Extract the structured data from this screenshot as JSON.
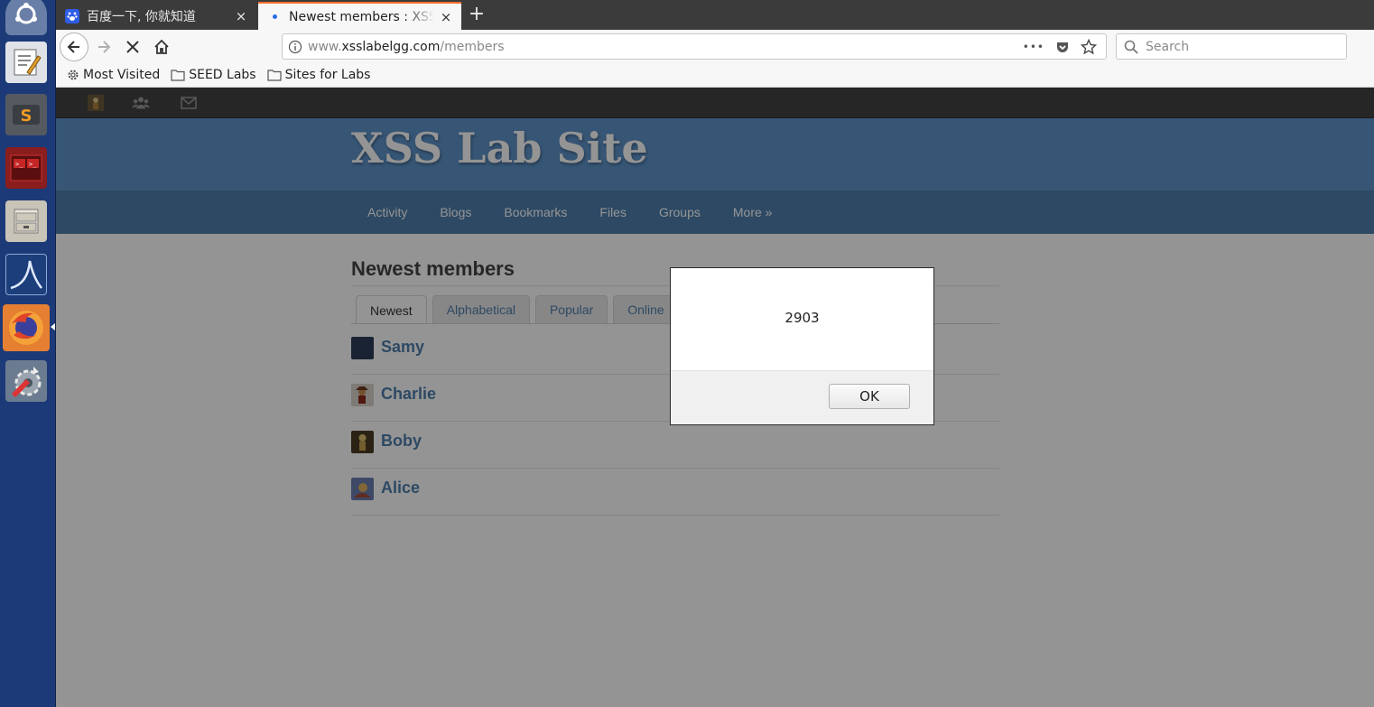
{
  "launcher": {
    "apps": [
      "ubuntu-dash",
      "text-editor",
      "sublime-text",
      "terminal",
      "files",
      "wireshark",
      "firefox",
      "system-settings"
    ]
  },
  "browser": {
    "tabs": [
      {
        "title": "百度一下, 你就知道",
        "close": "×"
      },
      {
        "title": "Newest members : XSS Lab Site",
        "close": "×"
      }
    ],
    "new_tab": "+",
    "url": {
      "prefix": "www.",
      "domain": "xsslabelgg.com",
      "path": "/members"
    },
    "search_placeholder": "Search",
    "url_more": "•••",
    "bookmarks": [
      "Most Visited",
      "SEED Labs",
      "Sites for Labs"
    ]
  },
  "site": {
    "title": "XSS Lab Site",
    "nav": [
      "Activity",
      "Blogs",
      "Bookmarks",
      "Files",
      "Groups",
      "More »"
    ],
    "page_title": "Newest members",
    "tabs": [
      "Newest",
      "Alphabetical",
      "Popular",
      "Online"
    ],
    "members": [
      "Samy",
      "Charlie",
      "Boby",
      "Alice"
    ]
  },
  "dialog": {
    "message": "2903",
    "ok_label": "OK"
  },
  "colors": {
    "header": "#5f94cb",
    "nav": "#4f7eac",
    "topbar": "#424242",
    "launcher": "#1d3a78",
    "link": "#4f7eac"
  }
}
